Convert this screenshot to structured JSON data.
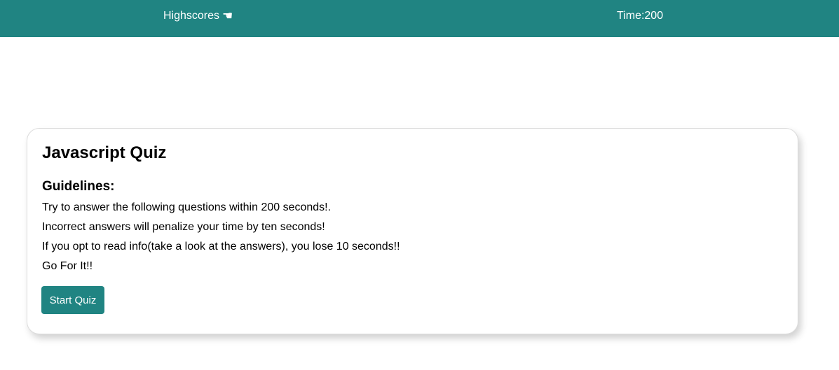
{
  "navbar": {
    "highscores_label": "Highscores",
    "highscores_icon": "pointing-hand-icon",
    "timer_label": "Time:",
    "timer_value": "200",
    "background_color": "#208482"
  },
  "card": {
    "title": "Javascript Quiz",
    "guidelines_heading": "Guidelines:",
    "guidelines": [
      "Try to answer the following questions within 200 seconds!.",
      "Incorrect answers will penalize your time by ten seconds!",
      "If you opt to read info(take a look at the answers), you lose 10 seconds!!",
      "Go For It!!"
    ],
    "start_button_label": "Start Quiz"
  },
  "colors": {
    "accent": "#208482"
  }
}
